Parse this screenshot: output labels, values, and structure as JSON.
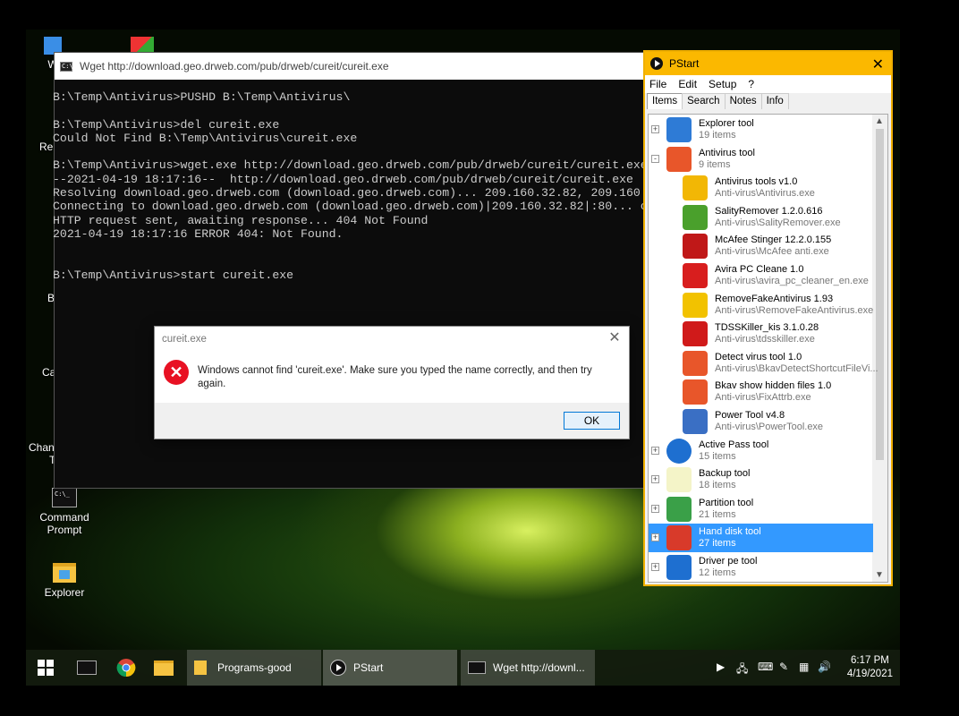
{
  "desktop": {
    "icons": [
      {
        "label": "Command\nPrompt"
      },
      {
        "label": "Explorer"
      }
    ],
    "partial_labels": [
      "W",
      "Re",
      "B",
      "Ca",
      "Chang",
      "T"
    ]
  },
  "console": {
    "title": "Wget http://download.geo.drweb.com/pub/drweb/cureit/cureit.exe",
    "lines": [
      "B:\\Temp\\Antivirus>PUSHD B:\\Temp\\Antivirus\\",
      "",
      "B:\\Temp\\Antivirus>del cureit.exe",
      "Could Not Find B:\\Temp\\Antivirus\\cureit.exe",
      "",
      "B:\\Temp\\Antivirus>wget.exe http://download.geo.drweb.com/pub/drweb/cureit/cureit.exe",
      "--2021-04-19 18:17:16--  http://download.geo.drweb.com/pub/drweb/cureit/cureit.exe",
      "Resolving download.geo.drweb.com (download.geo.drweb.com)... 209.160.32.82, 209.160.33",
      "Connecting to download.geo.drweb.com (download.geo.drweb.com)|209.160.32.82|:80... con",
      "HTTP request sent, awaiting response... 404 Not Found",
      "2021-04-19 18:17:16 ERROR 404: Not Found.",
      "",
      "",
      "B:\\Temp\\Antivirus>start cureit.exe"
    ]
  },
  "dialog": {
    "title": "cureit.exe",
    "message": "Windows cannot find 'cureit.exe'. Make sure you typed the name correctly, and then try again.",
    "ok_label": "OK"
  },
  "pstart": {
    "title": "PStart",
    "menu": [
      "File",
      "Edit",
      "Setup",
      "?"
    ],
    "tabs": [
      "Items",
      "Search",
      "Notes",
      "Info"
    ],
    "active_tab": "Items",
    "rows": [
      {
        "name": "Explorer tool",
        "sub": "19 items",
        "level": 0,
        "expander": "+",
        "icon": "windows-flag-icon",
        "color": "#2e7bd6"
      },
      {
        "name": "Antivirus tool",
        "sub": "9 items",
        "level": 0,
        "expander": "-",
        "icon": "shield-icon",
        "color": "#e8562a"
      },
      {
        "name": "Antivirus tools v1.0",
        "sub": "Anti-virus\\Antivirus.exe",
        "level": 1,
        "icon": "security-shield-icon",
        "color": "#f2b705"
      },
      {
        "name": "SalityRemover 1.2.0.616",
        "sub": "Anti-virus\\SalityRemover.exe",
        "level": 1,
        "icon": "sality-remover-icon",
        "color": "#4aa02c"
      },
      {
        "name": "McAfee Stinger 12.2.0.155",
        "sub": "Anti-virus\\McAfee anti.exe",
        "level": 1,
        "icon": "mcafee-icon",
        "color": "#c01818"
      },
      {
        "name": "Avira PC Cleane 1.0",
        "sub": "Anti-virus\\avira_pc_cleaner_en.exe",
        "level": 1,
        "icon": "avira-icon",
        "color": "#d81e1e"
      },
      {
        "name": "RemoveFakeAntivirus 1.93",
        "sub": "Anti-virus\\RemoveFakeAntivirus.exe",
        "level": 1,
        "icon": "remove-fake-icon",
        "color": "#f2c200"
      },
      {
        "name": "TDSSKiller_kis 3.1.0.28",
        "sub": "Anti-virus\\tdsskiller.exe",
        "level": 1,
        "icon": "kaspersky-icon",
        "color": "#d01a1a"
      },
      {
        "name": "Detect virus tool 1.0",
        "sub": "Anti-virus\\BkavDetectShortcutFileVi...",
        "level": 1,
        "icon": "shield-icon",
        "color": "#e8562a"
      },
      {
        "name": "Bkav show hidden files 1.0",
        "sub": "Anti-virus\\FixAttrb.exe",
        "level": 1,
        "icon": "shield-icon",
        "color": "#e8562a"
      },
      {
        "name": "Power Tool v4.8",
        "sub": "Anti-virus\\PowerTool.exe",
        "level": 1,
        "icon": "power-tool-icon",
        "color": "#3a6fc4"
      },
      {
        "name": "Active Pass tool",
        "sub": "15 items",
        "level": 0,
        "expander": "+",
        "icon": "windows-orb-icon",
        "color": "#1e6fd0"
      },
      {
        "name": "Backup tool",
        "sub": "18 items",
        "level": 0,
        "expander": "+",
        "icon": "ghost-icon",
        "color": "#f4f4c8"
      },
      {
        "name": "Partition tool",
        "sub": "21 items",
        "level": 0,
        "expander": "+",
        "icon": "partition-icon",
        "color": "#3aa048"
      },
      {
        "name": "Hand disk tool",
        "sub": "27 items",
        "level": 0,
        "expander": "+",
        "icon": "disk-cubes-icon",
        "color": "#d83a2a",
        "selected": true
      },
      {
        "name": "Driver pe tool",
        "sub": "12 items",
        "level": 0,
        "expander": "+",
        "icon": "driver-chart-icon",
        "color": "#1e6fd0"
      }
    ]
  },
  "taskbar": {
    "buttons": [
      {
        "label": "Programs-good",
        "icon": "folder-icon"
      },
      {
        "label": "PStart",
        "icon": "pstart-icon"
      },
      {
        "label": "Wget http://downl...",
        "icon": "cmd-icon"
      }
    ],
    "clock_time": "6:17 PM",
    "clock_date": "4/19/2021"
  }
}
